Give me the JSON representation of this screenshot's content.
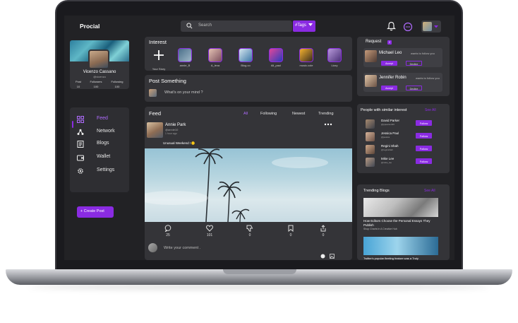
{
  "app": {
    "name": "Procial"
  },
  "topbar": {
    "search_placeholder": "Search",
    "tags_label": "#Tags"
  },
  "profile": {
    "name": "Vicenzo Cassano",
    "username": "@vicenzo",
    "stats": [
      {
        "label": "Post",
        "value": "10"
      },
      {
        "label": "Followers",
        "value": "100"
      },
      {
        "label": "Following",
        "value": "100"
      }
    ]
  },
  "nav": {
    "items": [
      {
        "label": "Feed",
        "icon": "feed-icon",
        "active": true
      },
      {
        "label": "Network",
        "icon": "network-icon",
        "active": false
      },
      {
        "label": "Blogs",
        "icon": "blog-icon",
        "active": false
      },
      {
        "label": "Wallet",
        "icon": "wallet-icon",
        "active": false
      },
      {
        "label": "Settings",
        "icon": "settings-icon",
        "active": false
      }
    ]
  },
  "create_post_label": "+ Create Post",
  "interest": {
    "title": "Interest",
    "stories": [
      {
        "label": "Your Story"
      },
      {
        "label": "annie_B"
      },
      {
        "label": "A_lexa"
      },
      {
        "label": "Blog.co"
      },
      {
        "label": "Ali_paul"
      },
      {
        "label": "music.cole"
      },
      {
        "label": "Lizzy"
      }
    ]
  },
  "post_something": {
    "title": "Post Something",
    "placeholder": "What's on your mind ?"
  },
  "feed": {
    "title": "Feed",
    "tabs": [
      "All",
      "Following",
      "Newest",
      "Trending"
    ],
    "post": {
      "name": "Annie Park",
      "username": "@annie10",
      "time": "1 hour ago",
      "caption": "Unusual Weekend !",
      "actions": [
        {
          "icon": "comment-icon",
          "count": "25"
        },
        {
          "icon": "heart-icon",
          "count": "101"
        },
        {
          "icon": "dislike-icon",
          "count": "0"
        },
        {
          "icon": "bookmark-icon",
          "count": "0"
        },
        {
          "icon": "share-icon",
          "count": "0"
        }
      ],
      "comment_placeholder": "Write your comment ."
    }
  },
  "request": {
    "title": "Request",
    "badge": "2",
    "items": [
      {
        "name": "Michael Leo",
        "note": "wants to follow you"
      },
      {
        "name": "Jennifer Robin",
        "note": "wants to follow you"
      }
    ],
    "accept_label": "Accept",
    "decline_label": "Decline"
  },
  "similar": {
    "title": "People with similar interest",
    "see_all": "See All",
    "people": [
      {
        "name": "David Parker",
        "username": "@ppearson00"
      },
      {
        "name": "Jessica Paul",
        "username": "@jessica"
      },
      {
        "name": "Regini Shah",
        "username": "@reginishah"
      },
      {
        "name": "Mike Lee",
        "username": "@mike_lee"
      }
    ],
    "follow_label": "Follow"
  },
  "trending": {
    "title": "Trending Blogs",
    "see_all": "See All",
    "blogs": [
      {
        "title": "How Editors Choose the Personal Essays They Publish",
        "source": "Shop Charts In A Creative Hub"
      },
      {
        "title": "Twitter's popular fleeting feature was a Truly"
      }
    ]
  },
  "colors": {
    "accent": "#8a2be2",
    "background": "#222225",
    "panel": "#343438"
  }
}
